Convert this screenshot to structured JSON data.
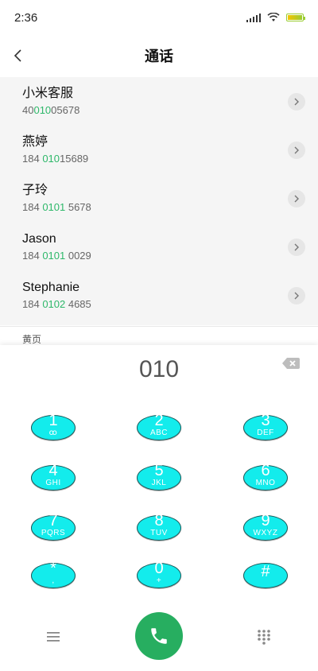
{
  "status": {
    "time": "2:36"
  },
  "header": {
    "title": "通话"
  },
  "results": [
    {
      "name": "小米客服",
      "num_pre": "40",
      "num_hl": "010",
      "num_post": "05678"
    },
    {
      "name": "燕婷",
      "num_pre": "184 ",
      "num_hl": "010",
      "num_post": "15689"
    },
    {
      "name": "子玲",
      "num_pre": "184 ",
      "num_hl": "0101",
      "num_post": " 5678"
    },
    {
      "name": "Jason",
      "num_pre": "184 ",
      "num_hl": "0101",
      "num_post": " 0029"
    },
    {
      "name": "Stephanie",
      "num_pre": "184 ",
      "num_hl": "0102",
      "num_post": " 4685"
    }
  ],
  "section": {
    "label": "黄页"
  },
  "dialer": {
    "display": "010",
    "keys": [
      {
        "digit": "1",
        "letters": "ꝏ"
      },
      {
        "digit": "2",
        "letters": "ABC"
      },
      {
        "digit": "3",
        "letters": "DEF"
      },
      {
        "digit": "4",
        "letters": "GHI"
      },
      {
        "digit": "5",
        "letters": "JKL"
      },
      {
        "digit": "6",
        "letters": "MNO"
      },
      {
        "digit": "7",
        "letters": "PQRS"
      },
      {
        "digit": "8",
        "letters": "TUV"
      },
      {
        "digit": "9",
        "letters": "WXYZ"
      },
      {
        "digit": "*",
        "letters": ","
      },
      {
        "digit": "0",
        "letters": "+"
      },
      {
        "digit": "#",
        "letters": ""
      }
    ]
  },
  "colors": {
    "key_fill": "#13ecec",
    "call_green": "#27ae60",
    "highlight_green": "#2eb86a"
  }
}
